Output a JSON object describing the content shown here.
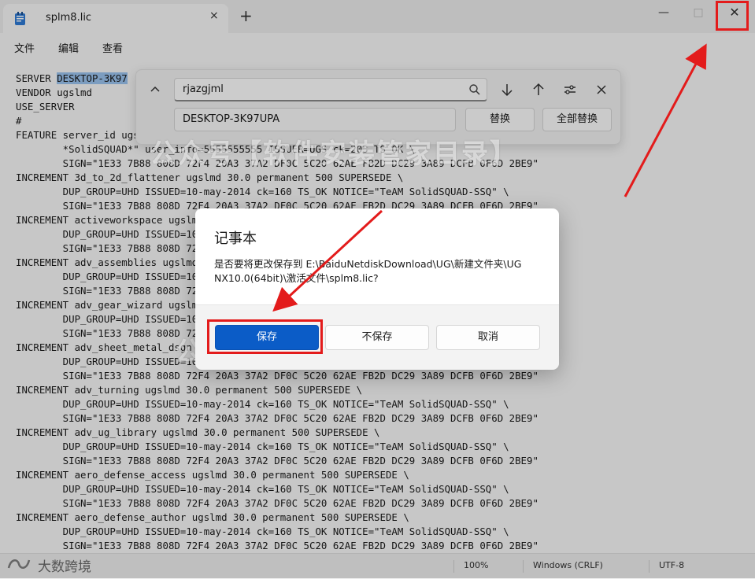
{
  "tab": {
    "title": "splm8.lic",
    "close": "×",
    "new": "+"
  },
  "window_controls": {
    "minimize": "—",
    "maximize": "□",
    "close": "✕"
  },
  "menu": [
    "文件",
    "编辑",
    "查看"
  ],
  "editor": {
    "lines": [
      {
        "pre": "SERVER ",
        "hl": "DESKTOP-3K97",
        "post": ""
      },
      {
        "pre": "VENDOR ugslmd"
      },
      {
        "pre": "USE_SERVER"
      },
      {
        "pre": "#"
      },
      {
        "pre": "FEATURE server_id ugslmd 30.0 permanent 1 SUPERSEDE \\"
      },
      {
        "pre": "        *SolidSQUAD*\" user_info=5555555555 ISSUER=UGS ck=203 TS_OK \\"
      },
      {
        "pre": "        SIGN=\"1E33 7B88 808D 72F4 20A3 37A2 DF0C 5C20 62AE FB2D DC29 3A89 DCFB 0F6D 2BE9\""
      },
      {
        "pre": "INCREMENT 3d_to_2d_flattener ugslmd 30.0 permanent 500 SUPERSEDE \\"
      },
      {
        "pre": "        DUP_GROUP=UHD ISSUED=10-may-2014 ck=160 TS_OK NOTICE=\"TeAM SolidSQUAD-SSQ\" \\"
      },
      {
        "pre": "        SIGN=\"1E33 7B88 808D 72F4 20A3 37A2 DF0C 5C20 62AE FB2D DC29 3A89 DCFB 0F6D 2BE9\""
      },
      {
        "pre": "INCREMENT activeworkspace ugslmd 30.0 permanent 500 SUPERSEDE \\"
      },
      {
        "pre": "        DUP_GROUP=UHD ISSUED=10-may-2014 ck=160 TS_OK NOTICE=\"TeAM SolidSQUAD-SSQ\" \\"
      },
      {
        "pre": "        SIGN=\"1E33 7B88 808D 72F4 20A3 37A2 DF0C 5C20 62AE FB2D DC29 3A89 DCFB 0F6D 2BE9\""
      },
      {
        "pre": "INCREMENT adv_assemblies ugslmd 30.0 permanent 500 SUPERSEDE \\"
      },
      {
        "pre": "        DUP_GROUP=UHD ISSUED=10-may-2014 ck=160 TS_OK NOTICE=\"TeAM SolidSQUAD-SSQ\" \\"
      },
      {
        "pre": "        SIGN=\"1E33 7B88 808D 72F4 20A3 37A2 DF0C 5C20 62AE FB2D DC29 3A89 DCFB 0F6D 2BE9\""
      },
      {
        "pre": "INCREMENT adv_gear_wizard ugslmd 30.0 permanent 500 SUPERSEDE \\"
      },
      {
        "pre": "        DUP_GROUP=UHD ISSUED=10-may-2014 ck=160 TS_OK NOTICE=\"TeAM SolidSQUAD-SSQ\" \\"
      },
      {
        "pre": "        SIGN=\"1E33 7B88 808D 72F4 20A3 37A2 DF0C 5C20 62AE FB2D DC29 3A89 DCFB 0F6D 2BE9\""
      },
      {
        "pre": "INCREMENT adv_sheet_metal_dsgn ugslmd 30.0 permanent 500 SUPERSEDE \\"
      },
      {
        "pre": "        DUP_GROUP=UHD ISSUED=10-may-2014 ck=160 TS_OK NOTICE=\"TeAM SolidSQUAD-SSQ\" \\"
      },
      {
        "pre": "        SIGN=\"1E33 7B88 808D 72F4 20A3 37A2 DF0C 5C20 62AE FB2D DC29 3A89 DCFB 0F6D 2BE9\""
      },
      {
        "pre": "INCREMENT adv_turning ugslmd 30.0 permanent 500 SUPERSEDE \\"
      },
      {
        "pre": "        DUP_GROUP=UHD ISSUED=10-may-2014 ck=160 TS_OK NOTICE=\"TeAM SolidSQUAD-SSQ\" \\"
      },
      {
        "pre": "        SIGN=\"1E33 7B88 808D 72F4 20A3 37A2 DF0C 5C20 62AE FB2D DC29 3A89 DCFB 0F6D 2BE9\""
      },
      {
        "pre": "INCREMENT adv_ug_library ugslmd 30.0 permanent 500 SUPERSEDE \\"
      },
      {
        "pre": "        DUP_GROUP=UHD ISSUED=10-may-2014 ck=160 TS_OK NOTICE=\"TeAM SolidSQUAD-SSQ\" \\"
      },
      {
        "pre": "        SIGN=\"1E33 7B88 808D 72F4 20A3 37A2 DF0C 5C20 62AE FB2D DC29 3A89 DCFB 0F6D 2BE9\""
      },
      {
        "pre": "INCREMENT aero_defense_access ugslmd 30.0 permanent 500 SUPERSEDE \\"
      },
      {
        "pre": "        DUP_GROUP=UHD ISSUED=10-may-2014 ck=160 TS_OK NOTICE=\"TeAM SolidSQUAD-SSQ\" \\"
      },
      {
        "pre": "        SIGN=\"1E33 7B88 808D 72F4 20A3 37A2 DF0C 5C20 62AE FB2D DC29 3A89 DCFB 0F6D 2BE9\""
      },
      {
        "pre": "INCREMENT aero_defense_author ugslmd 30.0 permanent 500 SUPERSEDE \\"
      },
      {
        "pre": "        DUP_GROUP=UHD ISSUED=10-may-2014 ck=160 TS_OK NOTICE=\"TeAM SolidSQUAD-SSQ\" \\"
      },
      {
        "pre": "        SIGN=\"1E33 7B88 808D 72F4 20A3 37A2 DF0C 5C20 62AE FB2D DC29 3A89 DCFB 0F6D 2BE9\""
      }
    ]
  },
  "find_replace": {
    "find_value": "rjazgjml",
    "replace_value": "DESKTOP-3K97UPA",
    "replace_button": "替换",
    "replace_all_button": "全部替换",
    "icons": [
      "chevron-up-icon",
      "search-icon",
      "arrow-down-icon",
      "arrow-up-icon",
      "options-icon",
      "close-icon"
    ]
  },
  "dialog": {
    "title": "记事本",
    "message": "是否要将更改保存到 E:\\BaiduNetdiskDownload\\UG\\新建文件夹\\UG NX10.0(64bit)\\激活文件\\splm8.lic?",
    "save": "保存",
    "dont_save": "不保存",
    "cancel": "取消"
  },
  "status": {
    "zoom": "100%",
    "line_ending": "Windows (CRLF)",
    "encoding": "UTF-8"
  },
  "watermark": "公众号【软件安装管家目录】",
  "logo_text": "大数跨境",
  "colors": {
    "primary_button": "#0b5cc7",
    "annotation_red": "#e31b1b",
    "selection": "#9bc5f1"
  }
}
